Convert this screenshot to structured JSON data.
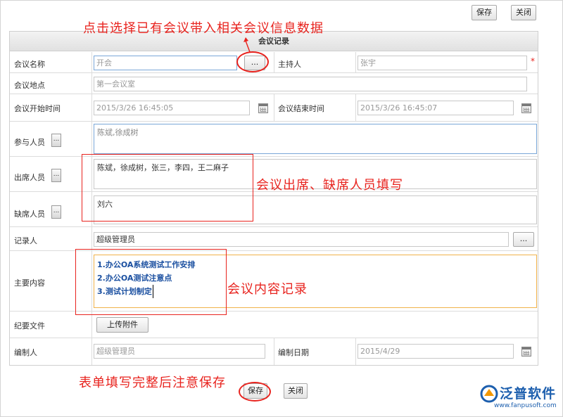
{
  "toolbar": {
    "save_label": "保存",
    "close_label": "关闭"
  },
  "form": {
    "title": "会议记录",
    "fields": {
      "meeting_name": {
        "label": "会议名称",
        "value": "开会",
        "pick_label": "..."
      },
      "host": {
        "label": "主持人",
        "value": "张宇",
        "required": "*"
      },
      "location": {
        "label": "会议地点",
        "value": "第一会议室"
      },
      "start_time": {
        "label": "会议开始时间",
        "value": "2015/3/26 16:45:05"
      },
      "end_time": {
        "label": "会议结束时间",
        "value": "2015/3/26 16:45:07"
      },
      "participants": {
        "label": "参与人员",
        "value": "陈斌,徐成树",
        "pick_label": "..."
      },
      "attendees": {
        "label": "出席人员",
        "value": "陈斌，徐成树，张三，李四，王二麻子",
        "pick_label": "..."
      },
      "absentees": {
        "label": "缺席人员",
        "value": "刘六",
        "pick_label": "..."
      },
      "recorder": {
        "label": "记录人",
        "value": "超级管理员",
        "pick_label": "..."
      },
      "content": {
        "label": "主要内容",
        "lines": [
          "1.办公OA系统测试工作安排",
          "2.办公OA测试注意点",
          "3.测试计划制定"
        ]
      },
      "files": {
        "label": "纪要文件",
        "upload_label": "上传附件"
      },
      "editor": {
        "label": "编制人",
        "value": "超级管理员"
      },
      "edit_date": {
        "label": "编制日期",
        "value": "2015/4/29"
      }
    }
  },
  "bottom": {
    "save_label": "保存",
    "close_label": "关闭"
  },
  "annotations": {
    "pick_note": "点击选择已有会议带入相关会议信息数据",
    "attendance_note": "会议出席、缺席人员填写",
    "content_note": "会议内容记录",
    "save_note": "表单填写完整后注意保存"
  },
  "logo": {
    "name": "泛普软件",
    "url": "www.fanpusoft.com"
  },
  "colors": {
    "annotation": "#e8231e",
    "content_text": "#1a4fa0",
    "content_border": "#f0b24a"
  }
}
